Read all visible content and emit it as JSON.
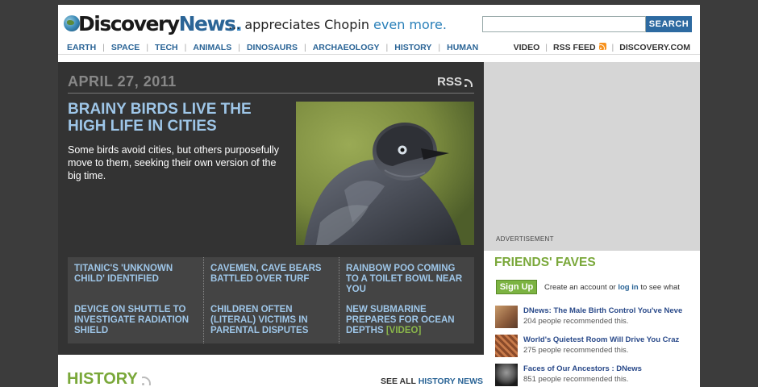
{
  "header": {
    "logo_word1": "Discovery",
    "logo_word2": "News",
    "logo_dot": ".",
    "tagline_prefix": "... appreciates Chopin ",
    "tagline_emphasis": "even more.",
    "search_placeholder": "",
    "search_button": "SEARCH"
  },
  "nav": {
    "items": [
      "EARTH",
      "SPACE",
      "TECH",
      "ANIMALS",
      "DINOSAURS",
      "ARCHAEOLOGY",
      "HISTORY",
      "HUMAN"
    ],
    "right": [
      "VIDEO",
      "RSS FEED",
      "DISCOVERY.COM"
    ]
  },
  "feature": {
    "date": "APRIL 27, 2011",
    "rss_label": "RSS",
    "headline": "BRAINY BIRDS LIVE THE HIGH LIFE IN CITIES",
    "dek": "Some birds avoid cities, but others purposefully move to them, seeking their own version of the big time."
  },
  "more_stories": [
    {
      "text": "TITANIC'S 'UNKNOWN CHILD' IDENTIFIED",
      "tag": ""
    },
    {
      "text": "CAVEMEN, CAVE BEARS BATTLED OVER TURF",
      "tag": ""
    },
    {
      "text": "RAINBOW POO COMING TO A TOILET BOWL NEAR YOU",
      "tag": ""
    },
    {
      "text": "DEVICE ON SHUTTLE TO INVESTIGATE RADIATION SHIELD",
      "tag": ""
    },
    {
      "text": "CHILDREN OFTEN (LITERAL) VICTIMS IN PARENTAL DISPUTES",
      "tag": ""
    },
    {
      "text": "NEW SUBMARINE PREPARES FOR OCEAN DEPTHS ",
      "tag": "[VIDEO]"
    }
  ],
  "history": {
    "title": "HISTORY",
    "see_all_prefix": "SEE ALL ",
    "see_all_link": "HISTORY NEWS"
  },
  "ad": {
    "label": "ADVERTISEMENT"
  },
  "friends": {
    "title": "FRIENDS' FAVES",
    "signup": "Sign Up",
    "acct_prefix": "Create an account or ",
    "acct_link": "log in",
    "acct_suffix": " to see what",
    "items": [
      {
        "title": "DNews: The Male Birth Control You've Neve",
        "count": "204 people recommended this."
      },
      {
        "title": "World's Quietest Room Will Drive You Craz",
        "count": "275 people recommended this."
      },
      {
        "title": "Faces of Our Ancestors : DNews",
        "count": "851 people recommended this."
      }
    ]
  },
  "colors": {
    "accent_blue": "#2a6496",
    "headline_blue": "#9ec6e8",
    "green": "#7aa83a",
    "rss_orange": "#f7921e"
  }
}
